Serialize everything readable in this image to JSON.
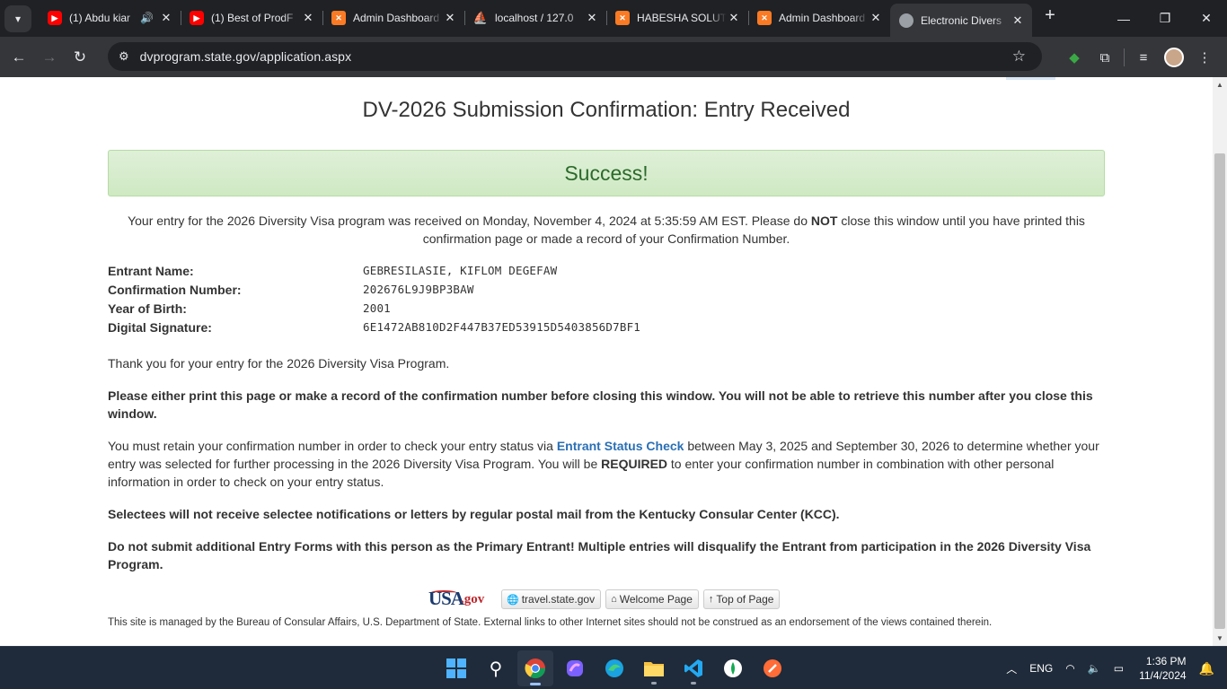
{
  "browser": {
    "tabs": [
      {
        "title": "(1) Abdu kiar",
        "favicon": "youtube-icon",
        "audio": true,
        "active": false
      },
      {
        "title": "(1) Best of ProdF",
        "favicon": "youtube-icon",
        "audio": false,
        "active": false
      },
      {
        "title": "Admin Dashboard",
        "favicon": "xampp-icon",
        "audio": false,
        "active": false
      },
      {
        "title": "localhost / 127.0",
        "favicon": "phpmyadmin-icon",
        "audio": false,
        "active": false
      },
      {
        "title": "HABESHA SOLUTI",
        "favicon": "xampp-icon",
        "audio": false,
        "active": false
      },
      {
        "title": "Admin Dashboard",
        "favicon": "xampp-icon",
        "audio": false,
        "active": false
      },
      {
        "title": "Electronic Divers",
        "favicon": "globe-icon",
        "audio": false,
        "active": true
      }
    ],
    "url": "dvprogram.state.gov/application.aspx"
  },
  "page": {
    "title": "DV-2026 Submission Confirmation: Entry Received",
    "success": "Success!",
    "received_text_1": "Your entry for the 2026 Diversity Visa program was received on Monday, November 4, 2024 at 5:35:59 AM EST. Please do ",
    "received_not": "NOT",
    "received_text_2": " close this window until you have printed this confirmation page or made a record of your Confirmation Number.",
    "details": [
      {
        "label": "Entrant Name:",
        "value": "GEBRESILASIE, KIFLOM DEGEFAW"
      },
      {
        "label": "Confirmation Number:",
        "value": "202676L9J9BP3BAW"
      },
      {
        "label": "Year of Birth:",
        "value": "2001"
      },
      {
        "label": "Digital Signature:",
        "value": "6E1472AB810D2F447B37ED53915D5403856D7BF1"
      }
    ],
    "thank_you": "Thank you for your entry for the 2026 Diversity Visa Program.",
    "print_warning": "Please either print this page or make a record of the confirmation number before closing this window. You will not be able to retrieve this number after you close this window.",
    "retain_1": "You must retain your confirmation number in order to check your entry status via ",
    "retain_link": "Entrant Status Check",
    "retain_2": " between May 3, 2025 and September 30, 2026 to determine whether your entry was selected for further processing in the 2026 Diversity Visa Program. You will be ",
    "retain_required": "REQUIRED",
    "retain_3": " to enter your confirmation number in combination with other personal information in order to check on your entry status.",
    "selectees": "Selectees will not receive selectee notifications or letters by regular postal mail from the Kentucky Consular Center (KCC).",
    "no_additional": "Do not submit additional Entry Forms with this person as the Primary Entrant! Multiple entries will disqualify the Entrant from participation in the 2026 Diversity Visa Program.",
    "footer": {
      "logo_usa": "USA",
      "logo_gov": ".gov",
      "links": [
        "travel.state.gov",
        "Welcome Page",
        "Top of Page"
      ],
      "disclaimer": "This site is managed by the Bureau of Consular Affairs, U.S. Department of State. External links to other Internet sites should not be construed as an endorsement of the views contained therein."
    }
  },
  "taskbar": {
    "language": "ENG",
    "time": "1:36 PM",
    "date": "11/4/2024"
  },
  "colors": {
    "success_bg": "#dff0d8",
    "success_text": "#2b6a2b",
    "link": "#2a6fb5",
    "chrome_dark": "#202124",
    "taskbar": "#1f2b3a"
  }
}
